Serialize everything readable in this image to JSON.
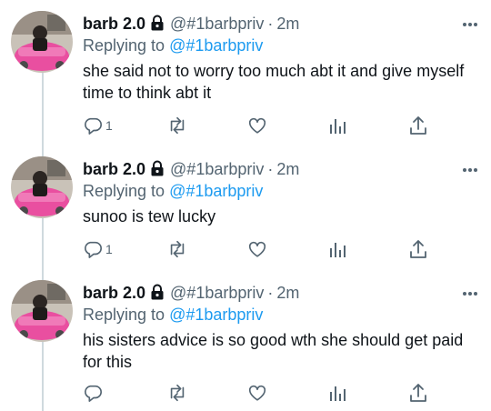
{
  "colors": {
    "text": "#0f1419",
    "secondary": "#536471",
    "link": "#1d9bf0",
    "thread_line": "#cfd9de"
  },
  "icons": {
    "more": "more-horizontal-icon",
    "lock": "lock-icon",
    "reply": "reply-icon",
    "retweet": "retweet-icon",
    "like": "heart-icon",
    "views": "views-icon",
    "share": "share-icon"
  },
  "tweets": [
    {
      "display_name": "barb 2.0",
      "handle": "@#1barbpriv",
      "separator": "·",
      "time": "2m",
      "replying_prefix": "Replying to",
      "replying_to": "@#1barbpriv",
      "text": "she said not to worry too much abt it and give myself time to think abt it",
      "reply_count": "1"
    },
    {
      "display_name": "barb 2.0",
      "handle": "@#1barbpriv",
      "separator": "·",
      "time": "2m",
      "replying_prefix": "Replying to",
      "replying_to": "@#1barbpriv",
      "text": "sunoo is tew lucky",
      "reply_count": "1"
    },
    {
      "display_name": "barb 2.0",
      "handle": "@#1barbpriv",
      "separator": "·",
      "time": "2m",
      "replying_prefix": "Replying to",
      "replying_to": "@#1barbpriv",
      "text": "his sisters advice is so good wth she should get paid for this",
      "reply_count": ""
    }
  ]
}
